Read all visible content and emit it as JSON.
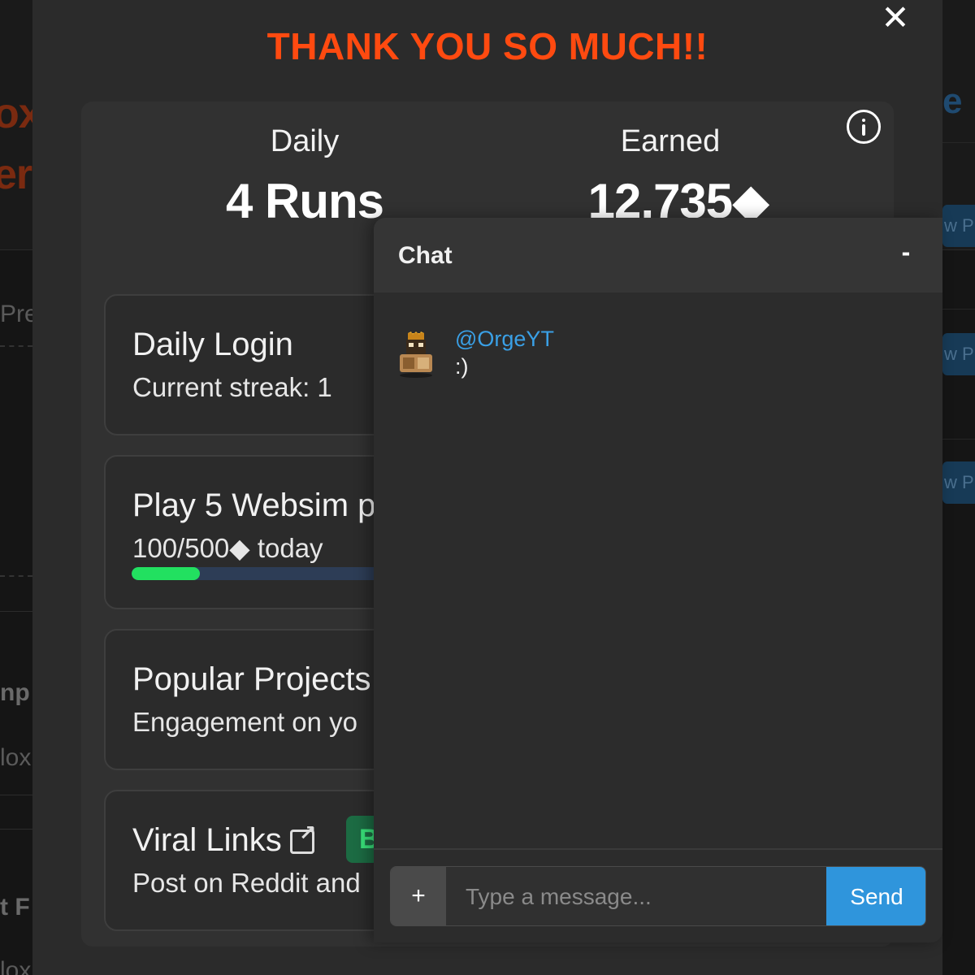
{
  "background": {
    "left_fragments": [
      "ox",
      "era",
      "Pre",
      "np",
      "lox",
      "t F",
      "lox"
    ],
    "right_fragments": [
      "e",
      "w P",
      "w P",
      "w P"
    ]
  },
  "modal": {
    "title": "THANK YOU SO MUCH!!",
    "close_label": "✕",
    "stats": {
      "daily_label": "Daily",
      "daily_value": "4 Runs",
      "earned_label": "Earned",
      "earned_value": "12,735◆"
    },
    "tasks": [
      {
        "title": "Daily Login",
        "subtitle": "Current streak: 1"
      },
      {
        "title": "Play 5 Websim p",
        "subtitle": "100/500◆ today",
        "progress_fraction": 0.2
      },
      {
        "title": "Popular Projects",
        "subtitle": "Engagement on yo"
      },
      {
        "title": "Viral Links",
        "badge": "B",
        "subtitle": "Post on Reddit and"
      }
    ]
  },
  "chat": {
    "title": "Chat",
    "minimize_label": "-",
    "messages": [
      {
        "username": "@OrgeYT",
        "text": ":)"
      }
    ],
    "input": {
      "plus_label": "+",
      "placeholder": "Type a message...",
      "value": "",
      "send_label": "Send"
    }
  },
  "colors": {
    "accent_title": "#ff4a10",
    "progress_fill": "#22e060",
    "send_button": "#2f95dc",
    "username": "#3aa0e6",
    "badge": "#1c6b43"
  },
  "icons": [
    "close-icon",
    "info-icon",
    "external-link-icon",
    "plus-icon",
    "avatar-icon"
  ]
}
